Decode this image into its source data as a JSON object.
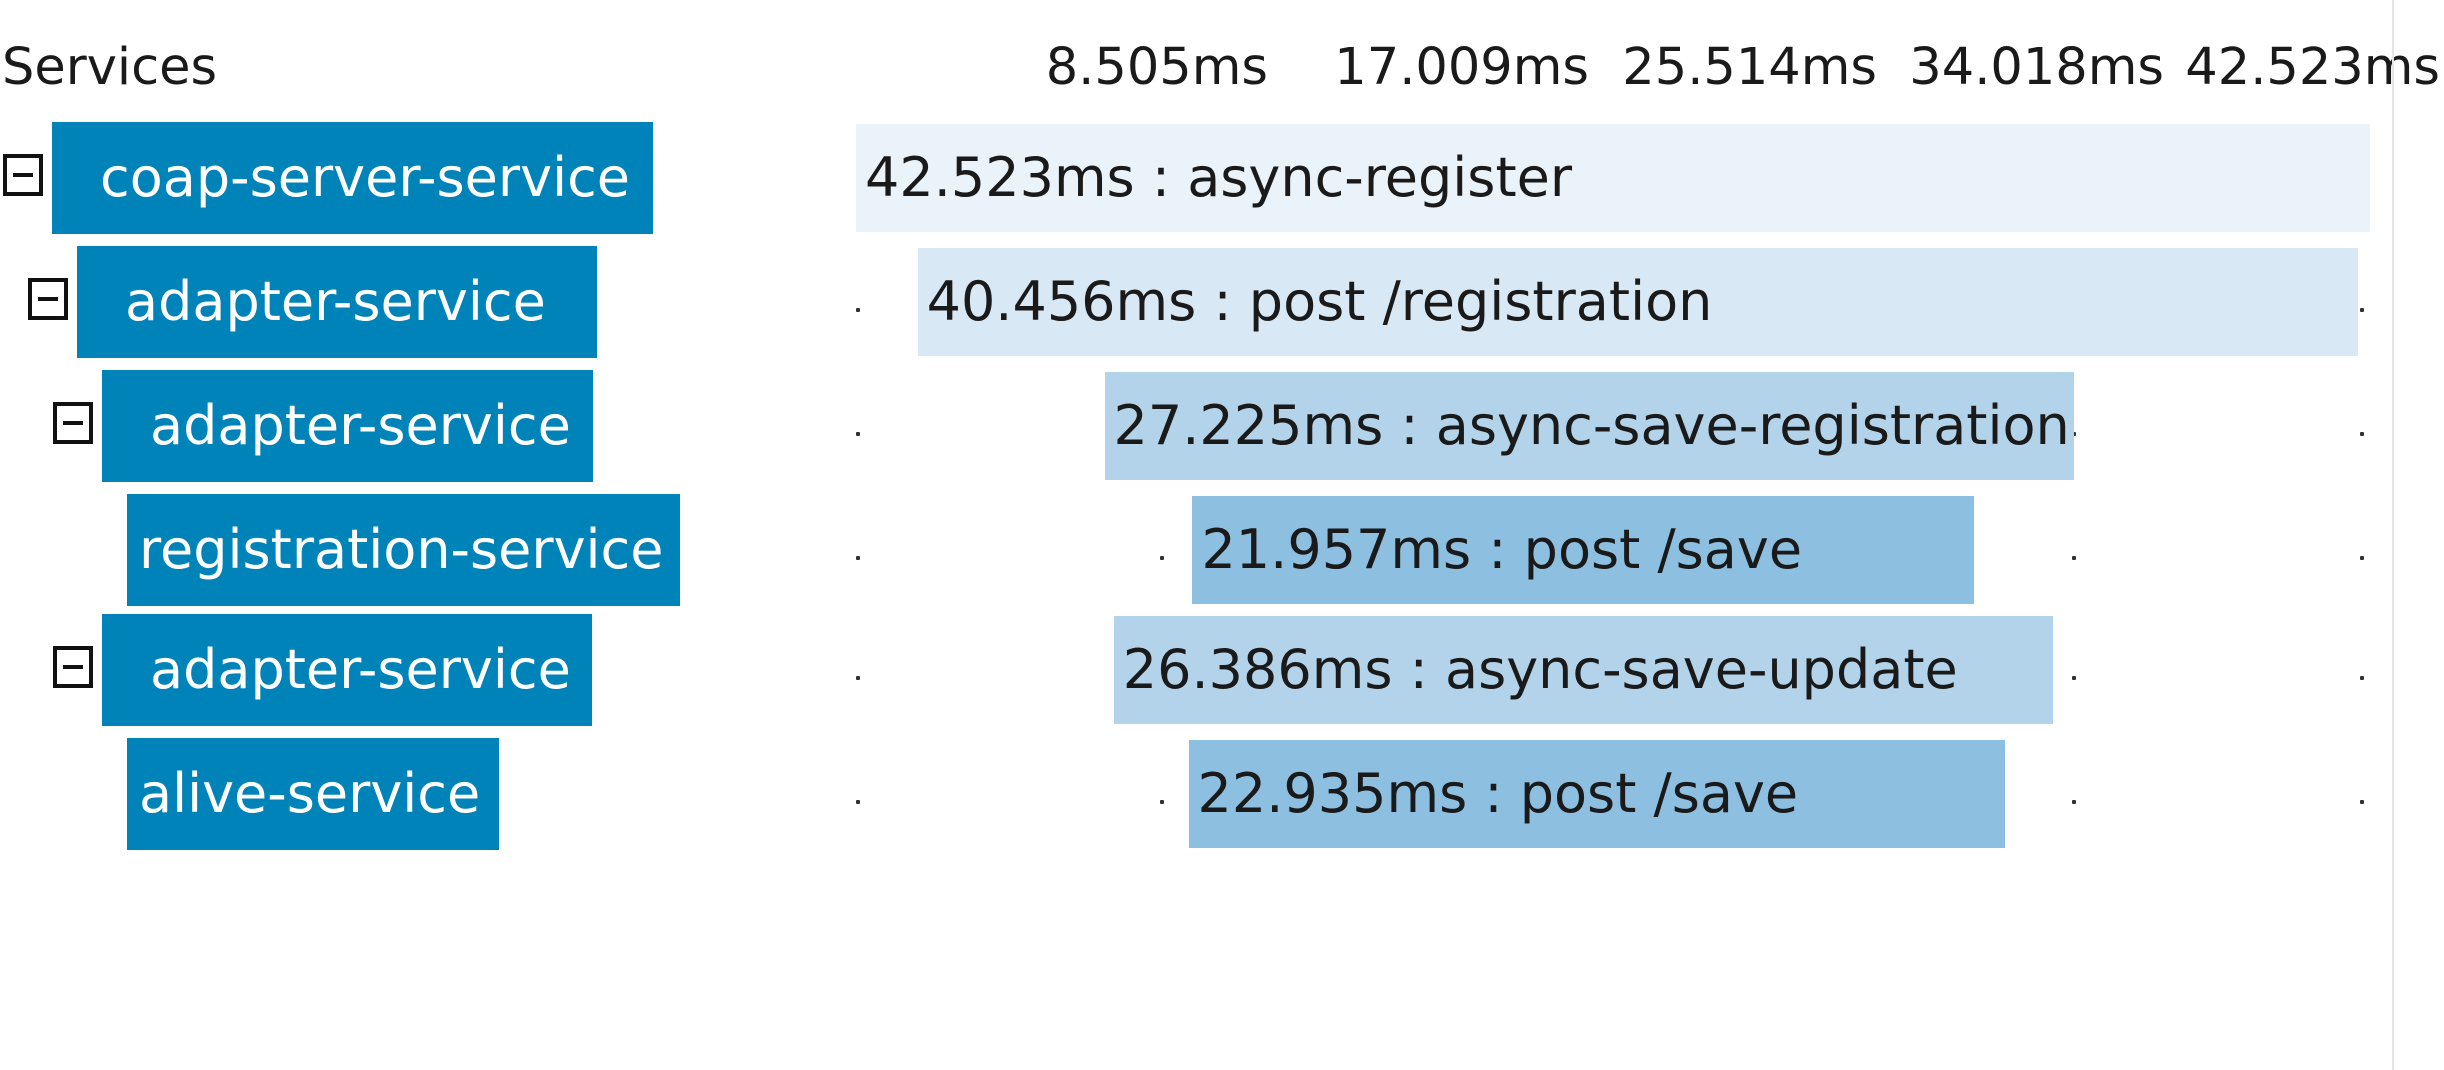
{
  "header": {
    "services_label": "Services"
  },
  "timeline": {
    "ticks": [
      "8.505ms",
      "17.009ms",
      "25.514ms",
      "34.018ms",
      "42.523ms"
    ]
  },
  "colors": {
    "service_box": "#0083b8",
    "span_colors": [
      "#ebf3fa",
      "#d8e8f4",
      "#b2d3e9",
      "#8cbfe0",
      "#b2d3e9",
      "#8cbfe0"
    ],
    "grid_dot": "#333333"
  },
  "rows": [
    {
      "service": "coap-server-service",
      "collapsible": true,
      "depth": 0,
      "duration": "42.523ms",
      "operation": "async-register",
      "label": "42.523ms : async-register",
      "start_ms": 0.0,
      "end_ms": 42.523
    },
    {
      "service": "adapter-service",
      "collapsible": true,
      "depth": 1,
      "duration": "40.456ms",
      "operation": "post /registration",
      "label": "40.456ms : post /registration",
      "start_ms": 1.73,
      "end_ms": 42.19
    },
    {
      "service": "adapter-service",
      "collapsible": true,
      "depth": 2,
      "duration": "27.225ms",
      "operation": "async-save-registration",
      "label": "27.225ms : async-save-registration",
      "start_ms": 6.98,
      "end_ms": 34.2
    },
    {
      "service": "registration-service",
      "collapsible": false,
      "depth": 3,
      "duration": "21.957ms",
      "operation": "post /save",
      "label": "21.957ms : post /save",
      "start_ms": 9.45,
      "end_ms": 31.4
    },
    {
      "service": "adapter-service",
      "collapsible": true,
      "depth": 2,
      "duration": "26.386ms",
      "operation": "async-save-update",
      "label": "26.386ms : async-save-update",
      "start_ms": 7.24,
      "end_ms": 33.62
    },
    {
      "service": "alive-service",
      "collapsible": false,
      "depth": 3,
      "duration": "22.935ms",
      "operation": "post /save",
      "label": "22.935ms : post /save",
      "start_ms": 9.34,
      "end_ms": 32.28
    }
  ]
}
